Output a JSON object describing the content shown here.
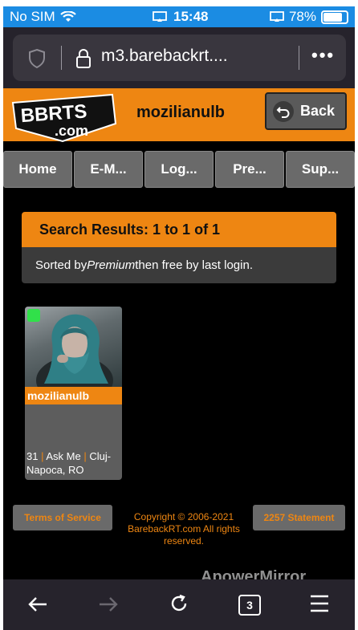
{
  "status_bar": {
    "carrier": "No SIM",
    "time": "15:48",
    "battery": "78%",
    "battery_level": 0.78
  },
  "browser": {
    "url": "m3.barebackrt....",
    "tabs_count": "3"
  },
  "site": {
    "logo_text_top": "BBRTS",
    "logo_text_bottom": ".com",
    "username": "mozilianulb",
    "back_label": "Back"
  },
  "nav": {
    "items": [
      "Home",
      "E-M...",
      "Log...",
      "Pre...",
      "Sup..."
    ]
  },
  "results": {
    "heading": "Search Results: 1 to 1 of 1",
    "sorted_prefix": "Sorted by ",
    "sorted_em": "Premium",
    "sorted_suffix": " then free by last login."
  },
  "profile": {
    "name": "mozilianulb",
    "age": "31",
    "role": "Ask Me",
    "location_part1": "Cluj-",
    "location_part2": "Napoca, RO",
    "separator": "|",
    "online_color": "#31e04a"
  },
  "footer": {
    "terms": "Terms of Service",
    "copyright": "Copyright © 2006-2021 BarebackRT.com All rights reserved.",
    "statement": "2257 Statement"
  },
  "watermark": "ApowerMirror",
  "colors": {
    "accent": "#ee8612",
    "status_bar": "#1b8ce3",
    "browser_bg": "#26232c"
  }
}
